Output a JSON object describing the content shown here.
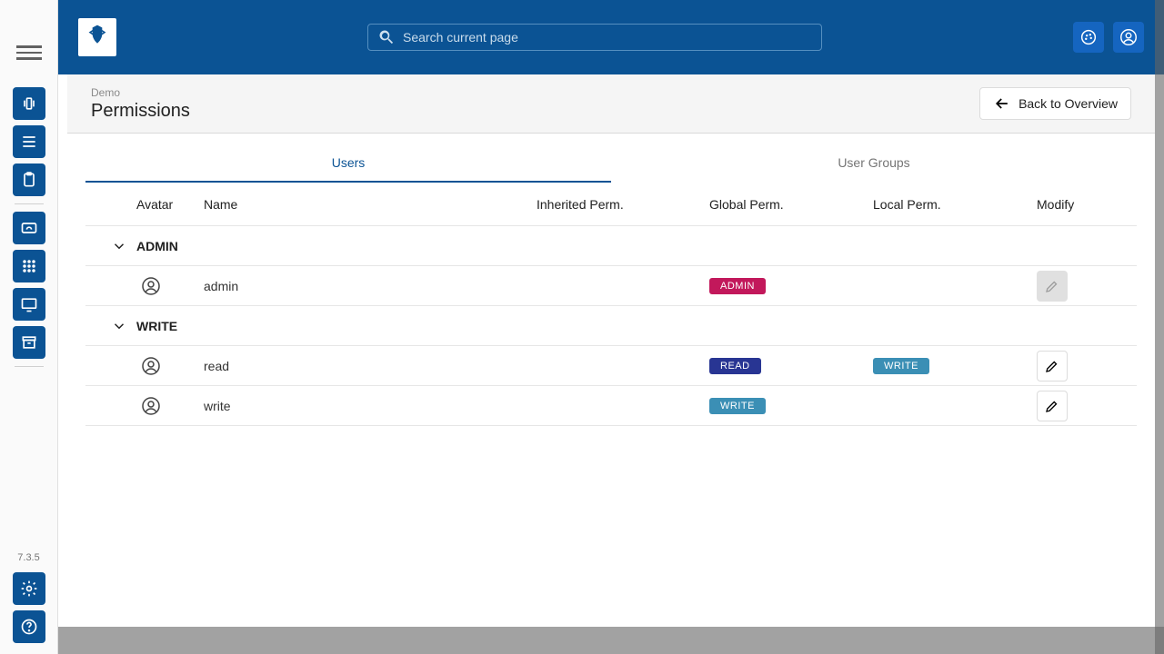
{
  "rail": {
    "version": "7.3.5"
  },
  "topbar": {
    "search_placeholder": "Search current page"
  },
  "page": {
    "crumb": "Demo",
    "title": "Permissions",
    "back_label": "Back to Overview"
  },
  "tabs": [
    {
      "label": "Users",
      "active": true
    },
    {
      "label": "User Groups",
      "active": false
    }
  ],
  "table": {
    "columns": {
      "avatar": "Avatar",
      "name": "Name",
      "inherited": "Inherited Perm.",
      "global": "Global Perm.",
      "local": "Local Perm.",
      "modify": "Modify"
    },
    "groups": [
      {
        "label": "ADMIN",
        "rows": [
          {
            "name": "admin",
            "global": "ADMIN",
            "global_kind": "admin",
            "local": "",
            "local_kind": "",
            "modifiable": false
          }
        ]
      },
      {
        "label": "WRITE",
        "rows": [
          {
            "name": "read",
            "global": "READ",
            "global_kind": "read",
            "local": "WRITE",
            "local_kind": "write",
            "modifiable": true
          },
          {
            "name": "write",
            "global": "WRITE",
            "global_kind": "write",
            "local": "",
            "local_kind": "",
            "modifiable": true
          }
        ]
      }
    ]
  }
}
